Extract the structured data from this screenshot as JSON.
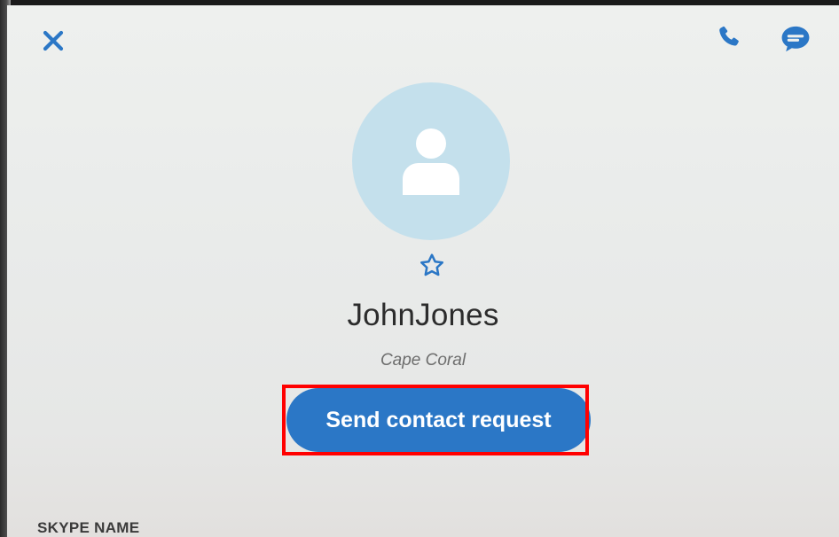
{
  "header": {
    "close_icon": "close-icon",
    "call_icon": "phone-icon",
    "chat_icon": "chat-icon"
  },
  "profile": {
    "avatar_icon": "default-avatar-icon",
    "favorite_icon": "star-outline-icon",
    "name": "JohnJones",
    "location": "Cape Coral"
  },
  "actions": {
    "send_request_label": "Send contact request"
  },
  "details": {
    "skype_name_label": "SKYPE NAME"
  },
  "colors": {
    "accent": "#2b77c6",
    "avatar_bg": "#c4e0ec",
    "highlight": "#ff0000"
  }
}
